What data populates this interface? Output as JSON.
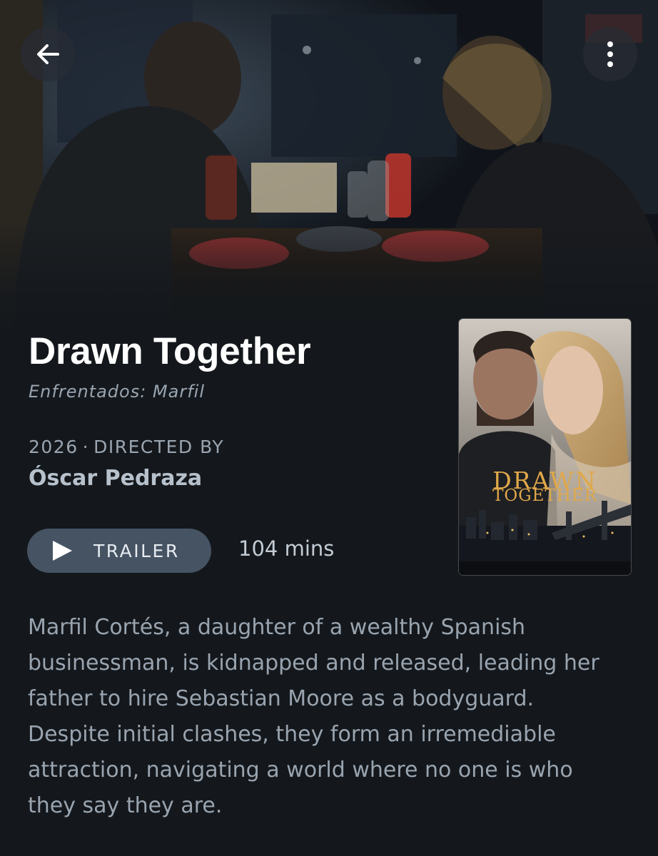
{
  "hero": {
    "image_description": "Two people sitting face to face at a diner table at night",
    "back_icon": "arrow-left-icon",
    "menu_icon": "more-vertical-icon"
  },
  "film": {
    "title": "Drawn Together",
    "original_title": "Enfrentados: Marfil",
    "year": "2026",
    "separator": "·",
    "directed_by_label": "DIRECTED BY",
    "director": "Óscar Pedraza",
    "runtime": "104 mins",
    "trailer_label": "TRAILER",
    "synopsis": "Marfil Cortés, a daughter of a wealthy Spanish businessman, is kidnapped and released, leading her father to hire Sebastian Moore as a bodyguard. Despite initial clashes, they form an irremediable attraction, navigating a world where no one is who they say they are."
  },
  "poster": {
    "title_line1": "DRAWN",
    "title_line2": "TOGETHER"
  },
  "colors": {
    "background": "#14181c",
    "button": "#465363",
    "muted_text": "#9aa5b1",
    "poster_title": "#e0a84a"
  }
}
